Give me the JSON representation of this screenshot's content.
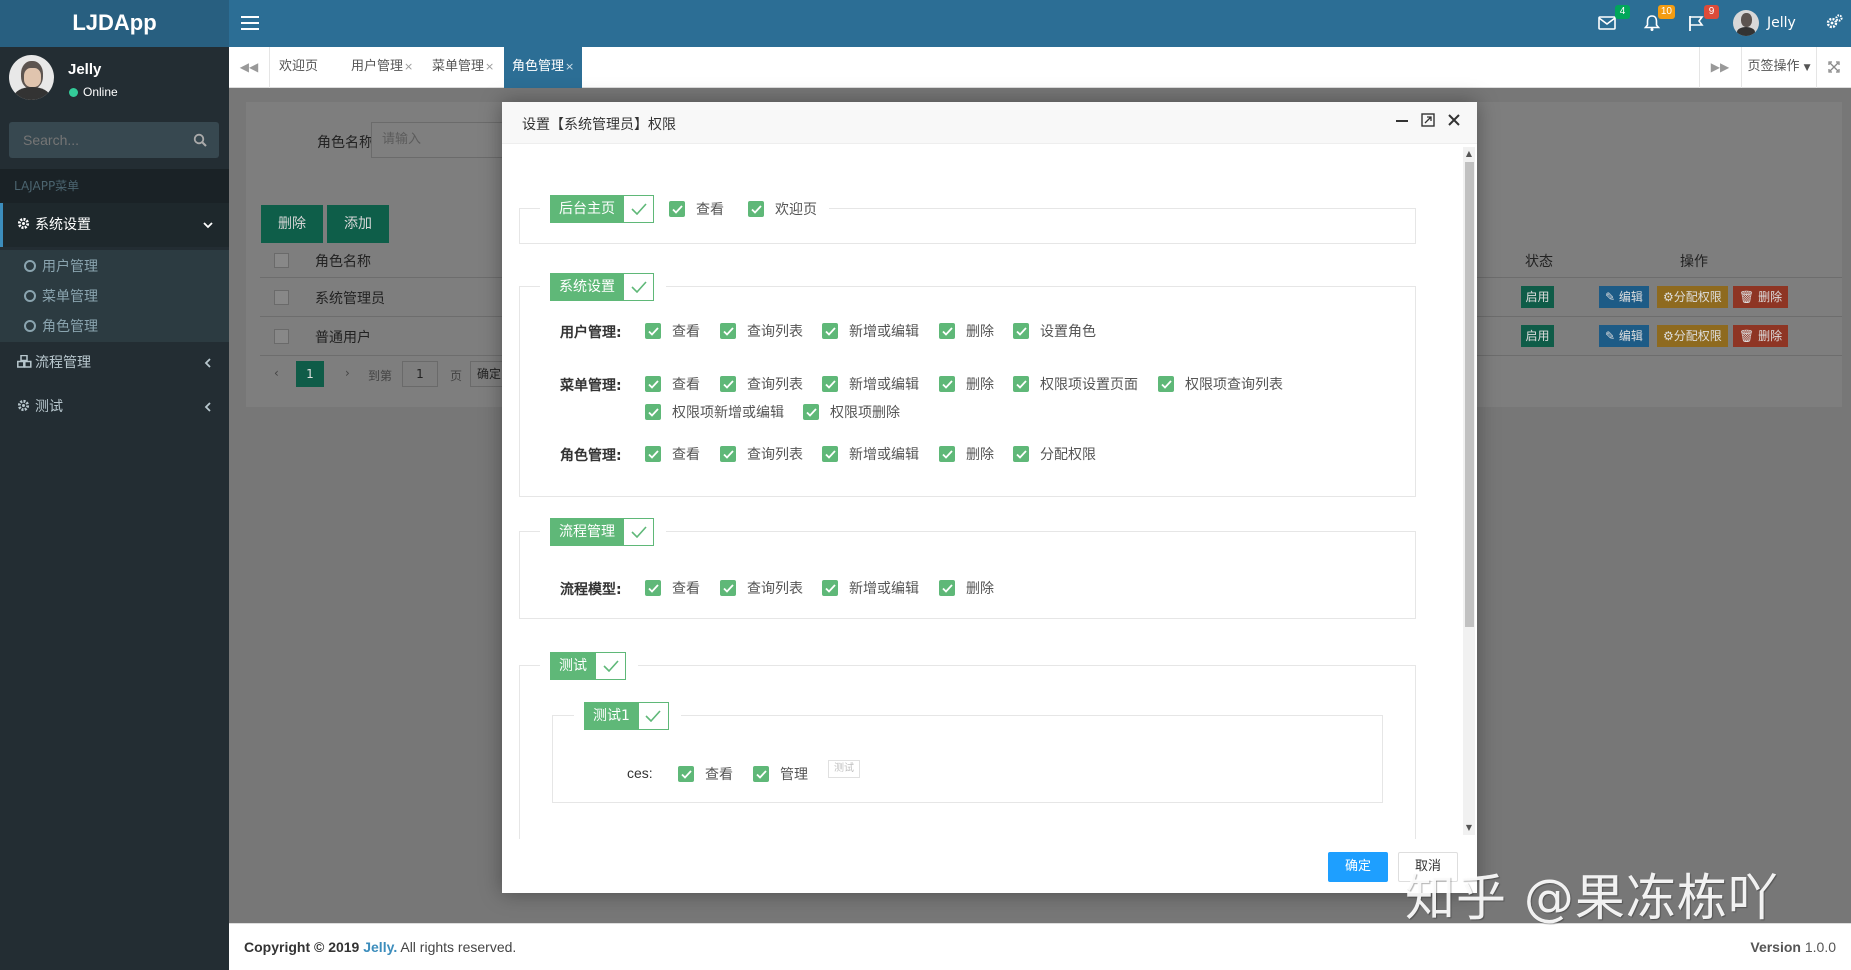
{
  "app": {
    "logo": "LJDApp"
  },
  "header": {
    "mail_count": "4",
    "bell_count": "10",
    "flag_count": "9",
    "user_name": "Jelly",
    "colors": {
      "bar": "#2c6e95",
      "mail_badge": "#00a65a",
      "bell_badge": "#f39c12",
      "flag_badge": "#dd4b39"
    }
  },
  "sidebar": {
    "user_name": "Jelly",
    "status": "Online",
    "search_placeholder": "Search...",
    "menu_header": "LAJAPP菜单",
    "items": [
      {
        "label": "系统设置",
        "icon": "gear-icon",
        "expanded": true,
        "children": [
          {
            "label": "用户管理"
          },
          {
            "label": "菜单管理"
          },
          {
            "label": "角色管理"
          }
        ]
      },
      {
        "label": "流程管理",
        "icon": "cubes-icon"
      },
      {
        "label": "测试",
        "icon": "gear-icon"
      }
    ]
  },
  "tabs": {
    "items": [
      {
        "label": "欢迎页"
      },
      {
        "label": "用户管理"
      },
      {
        "label": "菜单管理"
      },
      {
        "label": "角色管理",
        "active": true
      }
    ],
    "close_glyph": "×",
    "ops_label": "页签操作"
  },
  "page": {
    "search_label": "角色名称",
    "search_placeholder": "请输入",
    "btn_delete": "删除",
    "btn_add": "添加",
    "columns": {
      "name": "角色名称",
      "status": "状态",
      "ops": "操作"
    },
    "rows": [
      {
        "name": "系统管理员",
        "status": "启用"
      },
      {
        "name": "普通用户",
        "status": "启用"
      }
    ],
    "row_actions": {
      "edit": "编辑",
      "perm": "分配权限",
      "delete": "删除"
    },
    "pager": {
      "current": "1",
      "goto_label": "到第",
      "goto_value": "1",
      "page_unit": "页",
      "confirm": "确定"
    }
  },
  "modal": {
    "title": "设置【系统管理员】权限",
    "sections": [
      {
        "label": "后台主页",
        "inline": [
          "查看",
          "欢迎页"
        ]
      },
      {
        "label": "系统设置",
        "groups": [
          {
            "label": "用户管理:",
            "perms": [
              "查看",
              "查询列表",
              "新增或编辑",
              "删除",
              "设置角色"
            ]
          },
          {
            "label": "菜单管理:",
            "perms": [
              "查看",
              "查询列表",
              "新增或编辑",
              "删除",
              "权限项设置页面",
              "权限项查询列表",
              "权限项新增或编辑",
              "权限项删除"
            ]
          },
          {
            "label": "角色管理:",
            "perms": [
              "查看",
              "查询列表",
              "新增或编辑",
              "删除",
              "分配权限"
            ]
          }
        ]
      },
      {
        "label": "流程管理",
        "groups": [
          {
            "label": "流程模型:",
            "perms": [
              "查看",
              "查询列表",
              "新增或编辑",
              "删除"
            ]
          }
        ]
      },
      {
        "label": "测试",
        "sub": {
          "label": "测试1",
          "group_label": "ces:",
          "perms": [
            "查看",
            "管理"
          ],
          "extra_button": "测试"
        }
      }
    ],
    "ok": "确定",
    "cancel": "取消",
    "colors": {
      "check": "#5fb878",
      "ok": "#1e9fff"
    }
  },
  "footer": {
    "copyright_prefix": "Copyright © 2019 ",
    "brand": "Jelly.",
    "rights": " All rights reserved.",
    "version_label": "Version",
    "version": " 1.0.0"
  },
  "watermark": "知乎 @果冻栋吖"
}
